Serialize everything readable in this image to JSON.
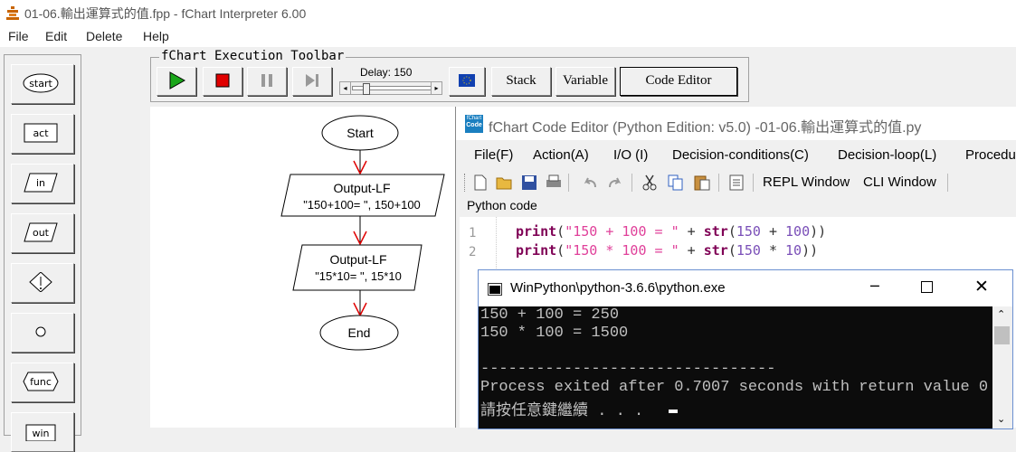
{
  "window": {
    "title": "01-06.輸出運算式的值.fpp - fChart Interpreter 6.00"
  },
  "menu": {
    "file": "File",
    "edit": "Edit",
    "delete": "Delete",
    "help": "Help"
  },
  "palette": {
    "items": [
      "start",
      "act",
      "in",
      "out",
      "",
      "",
      "func",
      "win"
    ]
  },
  "toolbar": {
    "legend": "fChart Execution Toolbar",
    "delay_label": "Delay: 150",
    "stack": "Stack",
    "variable": "Variable",
    "code_editor": "Code Editor",
    "colors": {
      "play": "#1aa61a",
      "stop": "#e00000"
    }
  },
  "flowchart": {
    "start": "Start",
    "out1_title": "Output-LF",
    "out1_expr": "\"150+100= \", 150+100",
    "out2_title": "Output-LF",
    "out2_expr": "\"15*10= \", 15*10",
    "end": "End",
    "arrow_color": "#e00000"
  },
  "editor": {
    "title": "fChart Code Editor (Python Edition:  v5.0) -01-06.輸出運算式的值.py",
    "menus": [
      "File(F)",
      "Action(A)",
      "I/O (I)",
      "Decision-conditions(C)",
      "Decision-loop(L)",
      "Procedu"
    ],
    "repl": "REPL Window",
    "cli": "CLI Window",
    "code_label": "Python code",
    "line_numbers": [
      "1",
      "2"
    ]
  },
  "console": {
    "title": "WinPython\\python-3.6.6\\python.exe",
    "lines": [
      "150 + 100 = 250",
      "150 * 100 = 1500",
      "",
      "--------------------------------",
      "Process exited after 0.7007 seconds with return value 0",
      "請按任意鍵繼續 . . . "
    ]
  }
}
